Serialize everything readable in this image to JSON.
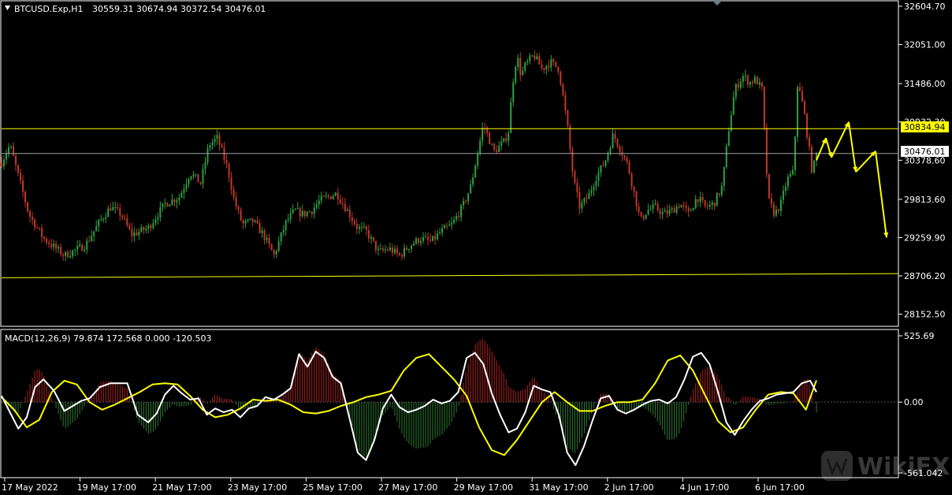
{
  "colors": {
    "background": "#000000",
    "frame": "#ffffff",
    "bull_candle": "#2ea043",
    "bear_candle": "#c0392b",
    "yellow": "#ffff00",
    "macd_line": "#ffffff",
    "signal_line": "#ffff00",
    "hist_pos": "#b22222",
    "hist_neg": "#2e7d32",
    "grey_line": "#a0a0a0"
  },
  "header": {
    "symbol_text": "BTCUSD.Exp,H1",
    "ohlc_text": "30559.31 30674.94 30372.54 30476.01"
  },
  "price_axis": {
    "tick_labels": [
      "32604.70",
      "32051.00",
      "31486.00",
      "30932.30",
      "30378.60",
      "29813.60",
      "29259.90",
      "28706.20",
      "28152.50"
    ],
    "min": 28000,
    "max": 32650
  },
  "price_tags": {
    "resistance_tag": "30834.94",
    "current_tag": "30476.01"
  },
  "macd_axis": {
    "tick_labels": [
      "525.69",
      "0.00",
      "-561.042"
    ],
    "max": 525.69,
    "min": -561.042
  },
  "macd_header": "MACD(12,26,9) 79.874 172.568 0.000 -120.503",
  "time_axis": {
    "labels": [
      "17 May 2022",
      "19 May 17:00",
      "21 May 17:00",
      "23 May 17:00",
      "25 May 17:00",
      "27 May 17:00",
      "29 May 17:00",
      "31 May 17:00",
      "2 Jun 17:00",
      "4 Jun 17:00",
      "6 Jun 17:00"
    ]
  },
  "watermark": {
    "text": "WikiFX",
    "icon": "wikifx-logo-icon"
  },
  "chart_data": [
    {
      "type": "candlestick",
      "symbol": "BTCUSD.Exp",
      "timeframe": "H1",
      "last_bar": {
        "open": 30559.31,
        "high": 30674.94,
        "low": 30372.54,
        "close": 30476.01
      },
      "ylim": [
        28000,
        32650
      ],
      "close_path": [
        [
          0,
          30350
        ],
        [
          40,
          30600
        ],
        [
          80,
          30150
        ],
        [
          130,
          29600
        ],
        [
          200,
          29250
        ],
        [
          300,
          29000
        ],
        [
          400,
          29150
        ],
        [
          470,
          29500
        ],
        [
          520,
          29700
        ],
        [
          570,
          29600
        ],
        [
          620,
          29300
        ],
        [
          700,
          29400
        ],
        [
          780,
          29750
        ],
        [
          850,
          29850
        ],
        [
          900,
          30200
        ],
        [
          950,
          30050
        ],
        [
          990,
          30600
        ],
        [
          1030,
          30700
        ],
        [
          1080,
          30250
        ],
        [
          1110,
          29800
        ],
        [
          1150,
          29450
        ],
        [
          1200,
          29500
        ],
        [
          1250,
          29300
        ],
        [
          1300,
          29000
        ],
        [
          1360,
          29500
        ],
        [
          1400,
          29650
        ],
        [
          1440,
          29600
        ],
        [
          1480,
          29650
        ],
        [
          1520,
          29800
        ],
        [
          1560,
          29850
        ],
        [
          1600,
          29900
        ],
        [
          1640,
          29700
        ],
        [
          1700,
          29400
        ],
        [
          1740,
          29350
        ],
        [
          1800,
          29050
        ],
        [
          1850,
          29100
        ],
        [
          1900,
          29000
        ],
        [
          1950,
          29150
        ],
        [
          2000,
          29250
        ],
        [
          2050,
          29200
        ],
        [
          2100,
          29350
        ],
        [
          2150,
          29450
        ],
        [
          2200,
          29700
        ],
        [
          2240,
          30000
        ],
        [
          2260,
          30300
        ],
        [
          2280,
          30600
        ],
        [
          2300,
          30900
        ],
        [
          2350,
          30500
        ],
        [
          2400,
          30650
        ],
        [
          2420,
          30800
        ],
        [
          2440,
          31500
        ],
        [
          2460,
          31900
        ],
        [
          2480,
          31600
        ],
        [
          2500,
          31750
        ],
        [
          2540,
          31900
        ],
        [
          2580,
          31700
        ],
        [
          2620,
          31800
        ],
        [
          2660,
          31700
        ],
        [
          2700,
          30900
        ],
        [
          2730,
          30100
        ],
        [
          2760,
          29700
        ],
        [
          2800,
          29850
        ],
        [
          2840,
          30150
        ],
        [
          2880,
          30350
        ],
        [
          2920,
          30750
        ],
        [
          2960,
          30500
        ],
        [
          2990,
          30300
        ],
        [
          3020,
          29900
        ],
        [
          3050,
          29500
        ],
        [
          3080,
          29650
        ],
        [
          3120,
          29700
        ],
        [
          3160,
          29600
        ],
        [
          3200,
          29650
        ],
        [
          3240,
          29750
        ],
        [
          3280,
          29600
        ],
        [
          3320,
          29850
        ],
        [
          3360,
          29700
        ],
        [
          3400,
          29750
        ],
        [
          3440,
          30000
        ],
        [
          3470,
          30800
        ],
        [
          3500,
          31400
        ],
        [
          3540,
          31600
        ],
        [
          3570,
          31500
        ],
        [
          3600,
          31550
        ],
        [
          3630,
          31400
        ],
        [
          3660,
          29800
        ],
        [
          3690,
          29600
        ],
        [
          3720,
          29750
        ],
        [
          3750,
          30100
        ],
        [
          3780,
          30200
        ],
        [
          3800,
          31500
        ],
        [
          3830,
          31100
        ],
        [
          3870,
          30200
        ],
        [
          3890,
          30476
        ]
      ]
    },
    {
      "type": "line",
      "title": "MACD(12,26,9)",
      "values": {
        "macd": 79.874,
        "signal": 172.568,
        "level": 0.0,
        "histogram": -120.503
      },
      "ylim": [
        -561.042,
        525.69
      ],
      "series": [
        {
          "name": "macd",
          "x": [
            0,
            40,
            80,
            120,
            160,
            200,
            250,
            300,
            340,
            380,
            420,
            470,
            520,
            560,
            600,
            650,
            700,
            740,
            780,
            820,
            860,
            900,
            940,
            980,
            1020,
            1060,
            1100,
            1140,
            1180,
            1220,
            1260,
            1300,
            1340,
            1380,
            1420,
            1460,
            1500,
            1540,
            1580,
            1620,
            1660,
            1700,
            1740,
            1780,
            1820,
            1860,
            1900,
            1940,
            1980,
            2020,
            2060,
            2100,
            2140,
            2180,
            2220,
            2260,
            2300,
            2340,
            2380,
            2420,
            2460,
            2500,
            2540,
            2580,
            2620,
            2660,
            2700,
            2740,
            2780,
            2820,
            2860,
            2900,
            2940,
            2980,
            3020,
            3060,
            3100,
            3140,
            3180,
            3220,
            3260,
            3300,
            3340,
            3380,
            3420,
            3460,
            3500,
            3540,
            3580,
            3620,
            3660,
            3700,
            3740,
            3780,
            3820,
            3860,
            3890
          ],
          "y": [
            50,
            -80,
            -210,
            -120,
            120,
            180,
            90,
            -70,
            -30,
            10,
            30,
            120,
            150,
            150,
            150,
            -100,
            -160,
            -90,
            60,
            130,
            70,
            20,
            30,
            -100,
            -50,
            -80,
            -60,
            -120,
            -50,
            -30,
            40,
            20,
            60,
            110,
            380,
            280,
            400,
            350,
            200,
            150,
            -120,
            -400,
            -460,
            -300,
            -50,
            60,
            -40,
            -80,
            -60,
            -30,
            20,
            -10,
            10,
            80,
            350,
            390,
            300,
            70,
            -100,
            -240,
            -210,
            -80,
            130,
            100,
            79.874,
            -100,
            -400,
            -500,
            -350,
            -150,
            30,
            50,
            -60,
            -90,
            -60,
            -20,
            10,
            20,
            -10,
            40,
            180,
            360,
            390,
            300,
            80,
            -160,
            -260,
            -150,
            -60,
            10,
            30,
            60,
            70,
            80,
            150,
            170,
            79.874
          ]
        },
        {
          "name": "signal",
          "x": [
            0,
            60,
            120,
            180,
            240,
            300,
            360,
            420,
            480,
            540,
            600,
            660,
            720,
            780,
            840,
            900,
            960,
            1020,
            1080,
            1140,
            1200,
            1260,
            1320,
            1380,
            1440,
            1500,
            1560,
            1620,
            1680,
            1740,
            1800,
            1860,
            1920,
            1980,
            2040,
            2100,
            2160,
            2220,
            2280,
            2340,
            2400,
            2460,
            2520,
            2580,
            2640,
            2700,
            2760,
            2820,
            2880,
            2940,
            3000,
            3060,
            3120,
            3180,
            3240,
            3300,
            3360,
            3420,
            3480,
            3540,
            3600,
            3660,
            3720,
            3780,
            3840,
            3890
          ],
          "y": [
            40,
            -60,
            -200,
            -140,
            80,
            170,
            140,
            0,
            -60,
            -20,
            30,
            80,
            140,
            150,
            140,
            50,
            -60,
            -120,
            -100,
            -50,
            20,
            10,
            20,
            -20,
            -80,
            -90,
            -70,
            -30,
            0,
            40,
            60,
            90,
            250,
            350,
            380,
            280,
            180,
            50,
            -200,
            -380,
            -420,
            -300,
            -150,
            0,
            80,
            0,
            -70,
            -70,
            -30,
            0,
            0,
            20,
            150,
            330,
            370,
            250,
            50,
            -150,
            -240,
            -200,
            -60,
            60,
            80,
            70,
            -60,
            172.568
          ]
        }
      ]
    }
  ],
  "annotations": {
    "resistance_level": 30834.94,
    "support_line_start": 28680,
    "support_line_end": 28740,
    "scenario_arrow_prices": [
      30378.6,
      30700,
      30420,
      30932.3,
      30210,
      30510,
      29260
    ]
  }
}
